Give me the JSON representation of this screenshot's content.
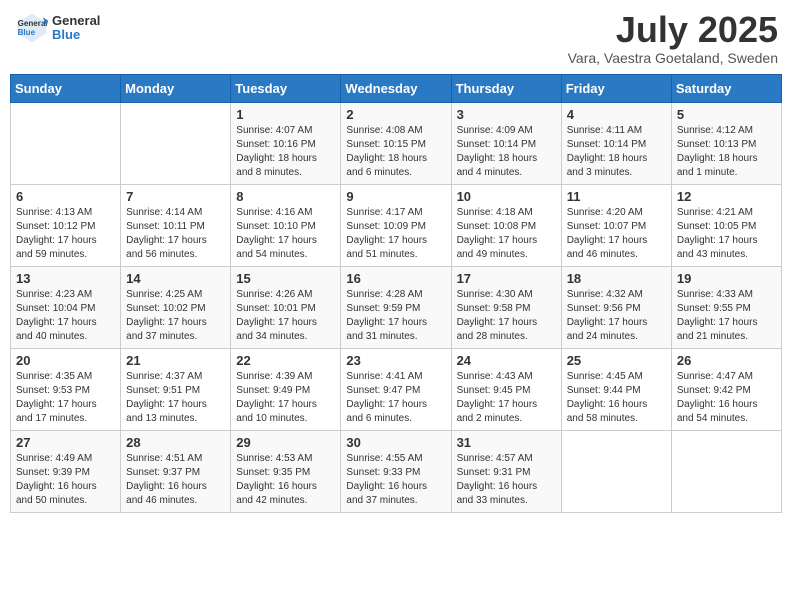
{
  "header": {
    "logo_general": "General",
    "logo_blue": "Blue",
    "month_title": "July 2025",
    "location": "Vara, Vaestra Goetaland, Sweden"
  },
  "weekdays": [
    "Sunday",
    "Monday",
    "Tuesday",
    "Wednesday",
    "Thursday",
    "Friday",
    "Saturday"
  ],
  "weeks": [
    [
      {
        "day": "",
        "sunrise": "",
        "sunset": "",
        "daylight": ""
      },
      {
        "day": "",
        "sunrise": "",
        "sunset": "",
        "daylight": ""
      },
      {
        "day": "1",
        "sunrise": "Sunrise: 4:07 AM",
        "sunset": "Sunset: 10:16 PM",
        "daylight": "Daylight: 18 hours and 8 minutes."
      },
      {
        "day": "2",
        "sunrise": "Sunrise: 4:08 AM",
        "sunset": "Sunset: 10:15 PM",
        "daylight": "Daylight: 18 hours and 6 minutes."
      },
      {
        "day": "3",
        "sunrise": "Sunrise: 4:09 AM",
        "sunset": "Sunset: 10:14 PM",
        "daylight": "Daylight: 18 hours and 4 minutes."
      },
      {
        "day": "4",
        "sunrise": "Sunrise: 4:11 AM",
        "sunset": "Sunset: 10:14 PM",
        "daylight": "Daylight: 18 hours and 3 minutes."
      },
      {
        "day": "5",
        "sunrise": "Sunrise: 4:12 AM",
        "sunset": "Sunset: 10:13 PM",
        "daylight": "Daylight: 18 hours and 1 minute."
      }
    ],
    [
      {
        "day": "6",
        "sunrise": "Sunrise: 4:13 AM",
        "sunset": "Sunset: 10:12 PM",
        "daylight": "Daylight: 17 hours and 59 minutes."
      },
      {
        "day": "7",
        "sunrise": "Sunrise: 4:14 AM",
        "sunset": "Sunset: 10:11 PM",
        "daylight": "Daylight: 17 hours and 56 minutes."
      },
      {
        "day": "8",
        "sunrise": "Sunrise: 4:16 AM",
        "sunset": "Sunset: 10:10 PM",
        "daylight": "Daylight: 17 hours and 54 minutes."
      },
      {
        "day": "9",
        "sunrise": "Sunrise: 4:17 AM",
        "sunset": "Sunset: 10:09 PM",
        "daylight": "Daylight: 17 hours and 51 minutes."
      },
      {
        "day": "10",
        "sunrise": "Sunrise: 4:18 AM",
        "sunset": "Sunset: 10:08 PM",
        "daylight": "Daylight: 17 hours and 49 minutes."
      },
      {
        "day": "11",
        "sunrise": "Sunrise: 4:20 AM",
        "sunset": "Sunset: 10:07 PM",
        "daylight": "Daylight: 17 hours and 46 minutes."
      },
      {
        "day": "12",
        "sunrise": "Sunrise: 4:21 AM",
        "sunset": "Sunset: 10:05 PM",
        "daylight": "Daylight: 17 hours and 43 minutes."
      }
    ],
    [
      {
        "day": "13",
        "sunrise": "Sunrise: 4:23 AM",
        "sunset": "Sunset: 10:04 PM",
        "daylight": "Daylight: 17 hours and 40 minutes."
      },
      {
        "day": "14",
        "sunrise": "Sunrise: 4:25 AM",
        "sunset": "Sunset: 10:02 PM",
        "daylight": "Daylight: 17 hours and 37 minutes."
      },
      {
        "day": "15",
        "sunrise": "Sunrise: 4:26 AM",
        "sunset": "Sunset: 10:01 PM",
        "daylight": "Daylight: 17 hours and 34 minutes."
      },
      {
        "day": "16",
        "sunrise": "Sunrise: 4:28 AM",
        "sunset": "Sunset: 9:59 PM",
        "daylight": "Daylight: 17 hours and 31 minutes."
      },
      {
        "day": "17",
        "sunrise": "Sunrise: 4:30 AM",
        "sunset": "Sunset: 9:58 PM",
        "daylight": "Daylight: 17 hours and 28 minutes."
      },
      {
        "day": "18",
        "sunrise": "Sunrise: 4:32 AM",
        "sunset": "Sunset: 9:56 PM",
        "daylight": "Daylight: 17 hours and 24 minutes."
      },
      {
        "day": "19",
        "sunrise": "Sunrise: 4:33 AM",
        "sunset": "Sunset: 9:55 PM",
        "daylight": "Daylight: 17 hours and 21 minutes."
      }
    ],
    [
      {
        "day": "20",
        "sunrise": "Sunrise: 4:35 AM",
        "sunset": "Sunset: 9:53 PM",
        "daylight": "Daylight: 17 hours and 17 minutes."
      },
      {
        "day": "21",
        "sunrise": "Sunrise: 4:37 AM",
        "sunset": "Sunset: 9:51 PM",
        "daylight": "Daylight: 17 hours and 13 minutes."
      },
      {
        "day": "22",
        "sunrise": "Sunrise: 4:39 AM",
        "sunset": "Sunset: 9:49 PM",
        "daylight": "Daylight: 17 hours and 10 minutes."
      },
      {
        "day": "23",
        "sunrise": "Sunrise: 4:41 AM",
        "sunset": "Sunset: 9:47 PM",
        "daylight": "Daylight: 17 hours and 6 minutes."
      },
      {
        "day": "24",
        "sunrise": "Sunrise: 4:43 AM",
        "sunset": "Sunset: 9:45 PM",
        "daylight": "Daylight: 17 hours and 2 minutes."
      },
      {
        "day": "25",
        "sunrise": "Sunrise: 4:45 AM",
        "sunset": "Sunset: 9:44 PM",
        "daylight": "Daylight: 16 hours and 58 minutes."
      },
      {
        "day": "26",
        "sunrise": "Sunrise: 4:47 AM",
        "sunset": "Sunset: 9:42 PM",
        "daylight": "Daylight: 16 hours and 54 minutes."
      }
    ],
    [
      {
        "day": "27",
        "sunrise": "Sunrise: 4:49 AM",
        "sunset": "Sunset: 9:39 PM",
        "daylight": "Daylight: 16 hours and 50 minutes."
      },
      {
        "day": "28",
        "sunrise": "Sunrise: 4:51 AM",
        "sunset": "Sunset: 9:37 PM",
        "daylight": "Daylight: 16 hours and 46 minutes."
      },
      {
        "day": "29",
        "sunrise": "Sunrise: 4:53 AM",
        "sunset": "Sunset: 9:35 PM",
        "daylight": "Daylight: 16 hours and 42 minutes."
      },
      {
        "day": "30",
        "sunrise": "Sunrise: 4:55 AM",
        "sunset": "Sunset: 9:33 PM",
        "daylight": "Daylight: 16 hours and 37 minutes."
      },
      {
        "day": "31",
        "sunrise": "Sunrise: 4:57 AM",
        "sunset": "Sunset: 9:31 PM",
        "daylight": "Daylight: 16 hours and 33 minutes."
      },
      {
        "day": "",
        "sunrise": "",
        "sunset": "",
        "daylight": ""
      },
      {
        "day": "",
        "sunrise": "",
        "sunset": "",
        "daylight": ""
      }
    ]
  ]
}
